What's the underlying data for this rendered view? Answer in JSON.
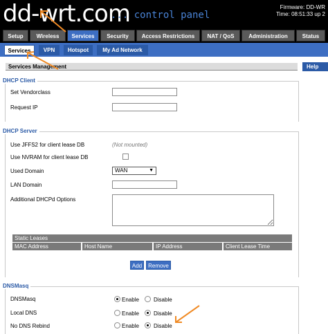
{
  "header": {
    "logo": "dd-wrt.com",
    "tagline": "... control panel",
    "firmware": "Firmware: DD-WR",
    "time": "Time: 08:51:33 up 2"
  },
  "tabs": [
    "Setup",
    "Wireless",
    "Services",
    "Security",
    "Access Restrictions",
    "NAT / QoS",
    "Administration",
    "Status"
  ],
  "subtabs": [
    "Services",
    "VPN",
    "Hotspot",
    "My Ad Network"
  ],
  "section_title": "Services Management",
  "help_label": "Help",
  "dhcp_client": {
    "title": "DHCP Client",
    "vendorclass_label": "Set Vendorclass",
    "vendorclass_value": "",
    "request_ip_label": "Request IP",
    "request_ip_value": ""
  },
  "dhcp_server": {
    "title": "DHCP Server",
    "jffs2_label": "Use JFFS2 for client lease DB",
    "jffs2_note": "(Not mounted)",
    "nvram_label": "Use NVRAM for client lease DB",
    "used_domain_label": "Used Domain",
    "used_domain_value": "WAN",
    "lan_domain_label": "LAN Domain",
    "lan_domain_value": "",
    "options_label": "Additional DHCPd Options",
    "options_value": "",
    "static_leases": "Static Leases",
    "columns": [
      "MAC Address",
      "Host Name",
      "IP Address",
      "Client Lease Time"
    ],
    "add_label": "Add",
    "remove_label": "Remove"
  },
  "dnsmasq": {
    "title": "DNSMasq",
    "enable": "Enable",
    "disable": "Disable",
    "rows": [
      {
        "label": "DNSMasq",
        "value": "Enable"
      },
      {
        "label": "Local DNS",
        "value": "Disable"
      },
      {
        "label": "No DNS Rebind",
        "value": "Disable"
      }
    ]
  },
  "colors": {
    "accent": "#3d6ec2",
    "annotation_arrow": "#f08a24"
  }
}
